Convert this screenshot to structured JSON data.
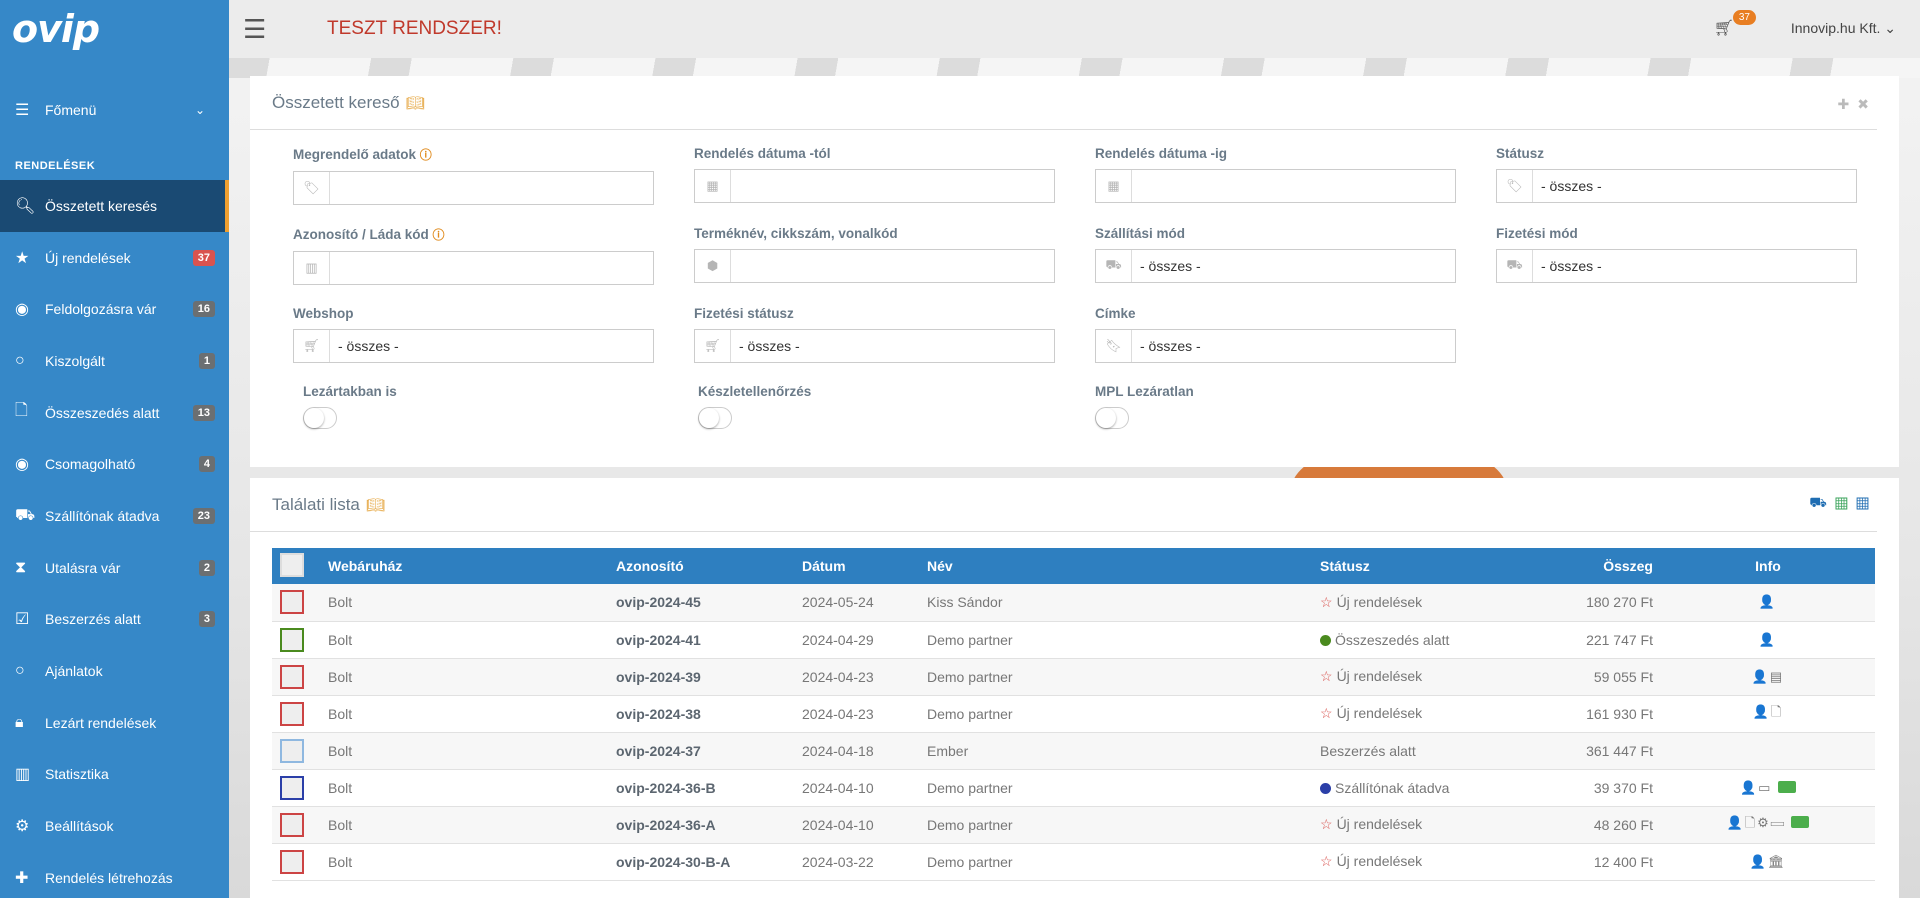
{
  "app": {
    "logo": "ovip",
    "system_title": "TESZT RENDSZER!",
    "cart_count": "37",
    "company": "Innovip.hu Kft. ⌄"
  },
  "sidebar": {
    "main_menu": "Főmenü",
    "section": "RENDELÉSEK",
    "items": [
      {
        "label": "Összetett keresés",
        "icon": "search-icon",
        "badge": ""
      },
      {
        "label": "Új rendelések",
        "icon": "star-icon",
        "badge": "37"
      },
      {
        "label": "Feldolgozásra vár",
        "icon": "eye-icon",
        "badge": "16"
      },
      {
        "label": "Kiszolgált",
        "icon": "circle-icon",
        "badge": "1"
      },
      {
        "label": "Összeszedés alatt",
        "icon": "file-icon",
        "badge": "13"
      },
      {
        "label": "Csomagolható",
        "icon": "eye-icon",
        "badge": "4"
      },
      {
        "label": "Szállítónak átadva",
        "icon": "truck-icon",
        "badge": "23"
      },
      {
        "label": "Utalásra vár",
        "icon": "hourglass-icon",
        "badge": "2"
      },
      {
        "label": "Beszerzés alatt",
        "icon": "checkbox-icon",
        "badge": "3"
      },
      {
        "label": "Ajánlatok",
        "icon": "circle-icon",
        "badge": ""
      },
      {
        "label": "Lezárt rendelések",
        "icon": "lock-icon",
        "badge": ""
      },
      {
        "label": "Statisztika",
        "icon": "chart-icon",
        "badge": ""
      },
      {
        "label": "Beállítások",
        "icon": "gear-icon",
        "badge": ""
      },
      {
        "label": "Rendelés létrehozás",
        "icon": "plus-icon",
        "badge": ""
      }
    ]
  },
  "search": {
    "title": "Összetett kereső",
    "fields": {
      "customer": {
        "label": "Megrendelő adatok",
        "value": ""
      },
      "date_from": {
        "label": "Rendelés dátuma -tól",
        "value": ""
      },
      "date_to": {
        "label": "Rendelés dátuma -ig",
        "value": ""
      },
      "status": {
        "label": "Státusz",
        "value": "- összes -"
      },
      "box_id": {
        "label": "Azonosító / Láda kód",
        "value": ""
      },
      "product": {
        "label": "Terméknév, cikkszám, vonalkód",
        "value": ""
      },
      "shipping": {
        "label": "Szállítási mód",
        "value": "- összes -"
      },
      "payment": {
        "label": "Fizetési mód",
        "value": "- összes -"
      },
      "webshop": {
        "label": "Webshop",
        "value": "- összes -"
      },
      "payment_status": {
        "label": "Fizetési státusz",
        "value": "- összes -"
      },
      "tag": {
        "label": "Címke",
        "value": "- összes -"
      }
    },
    "toggles": {
      "closed": "Lezártakban is",
      "stock": "Készletellenőrzés",
      "mpl": "MPL Lezáratlan"
    }
  },
  "results": {
    "title": "Találati lista",
    "columns": {
      "shop": "Webáruház",
      "id": "Azonosító",
      "date": "Dátum",
      "name": "Név",
      "status": "Státusz",
      "amount": "Összeg",
      "info": "Info"
    },
    "rows": [
      {
        "shop": "Bolt",
        "id": "ovip-2024-45",
        "date": "2024-05-24",
        "name": "Kiss Sándor",
        "status": "Új rendelések",
        "amount": "180 270 Ft",
        "info": "👤"
      },
      {
        "shop": "Bolt",
        "id": "ovip-2024-41",
        "date": "2024-04-29",
        "name": "Demo partner",
        "status": "Összeszedés alatt",
        "amount": "221 747 Ft",
        "info": "👤"
      },
      {
        "shop": "Bolt",
        "id": "ovip-2024-39",
        "date": "2024-04-23",
        "name": "Demo partner",
        "status": "Új rendelések",
        "amount": "59 055 Ft",
        "info": "👤▤"
      },
      {
        "shop": "Bolt",
        "id": "ovip-2024-38",
        "date": "2024-04-23",
        "name": "Demo partner",
        "status": "Új rendelések",
        "amount": "161 930 Ft",
        "info": "👤🗋"
      },
      {
        "shop": "Bolt",
        "id": "ovip-2024-37",
        "date": "2024-04-18",
        "name": "Ember",
        "status": "Beszerzés alatt",
        "amount": "361 447 Ft",
        "info": ""
      },
      {
        "shop": "Bolt",
        "id": "ovip-2024-36-B",
        "date": "2024-04-10",
        "name": "Demo partner",
        "status": "Szállítónak átadva",
        "amount": "39 370 Ft",
        "info": "👤▭"
      },
      {
        "shop": "Bolt",
        "id": "ovip-2024-36-A",
        "date": "2024-04-10",
        "name": "Demo partner",
        "status": "Új rendelések",
        "amount": "48 260 Ft",
        "info": "👤🗋⚙▭"
      },
      {
        "shop": "Bolt",
        "id": "ovip-2024-30-B-A",
        "date": "2024-03-22",
        "name": "Demo partner",
        "status": "Új rendelések",
        "amount": "12 400 Ft",
        "info": "👤🏛"
      }
    ]
  },
  "colors": {
    "sidebar": "#3688c8",
    "sidebar_active": "#1a4a73",
    "accent": "#f0a030",
    "table_header": "#2e7fc0",
    "status_green": "#4a8a1e",
    "status_blue": "#2b3fa8",
    "alert": "#c0392b"
  }
}
